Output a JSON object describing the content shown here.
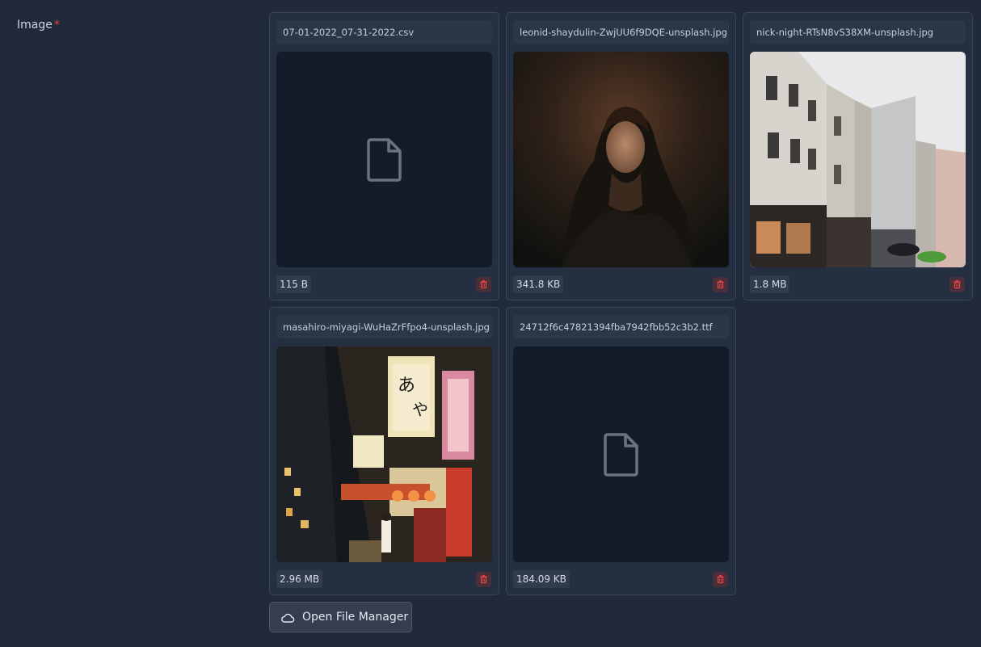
{
  "field": {
    "label": "Image",
    "required_mark": "*"
  },
  "files": [
    {
      "name": "07-01-2022_07-31-2022.csv",
      "size": "115 B",
      "preview": "document-icon"
    },
    {
      "name": "leonid-shaydulin-ZwjUU6f9DQE-unsplash.jpg",
      "size": "341.8 KB",
      "preview": "portrait-photo"
    },
    {
      "name": "nick-night-RTsN8vS38XM-unsplash.jpg",
      "size": "1.8 MB",
      "preview": "street-buildings-photo"
    },
    {
      "name": "masahiro-miyagi-WuHaZrFfpo4-unsplash.jpg",
      "size": "2.96 MB",
      "preview": "night-street-photo"
    },
    {
      "name": "24712f6c47821394fba7942fbb52c3b2.ttf",
      "size": "184.09 KB",
      "preview": "document-icon"
    }
  ],
  "actions": {
    "open_file_manager": "Open File Manager",
    "icon": "cloud-icon"
  },
  "colors": {
    "background": "#202a3b",
    "card": "#242f41",
    "delete": "#ef4444",
    "required": "#ef4444"
  }
}
